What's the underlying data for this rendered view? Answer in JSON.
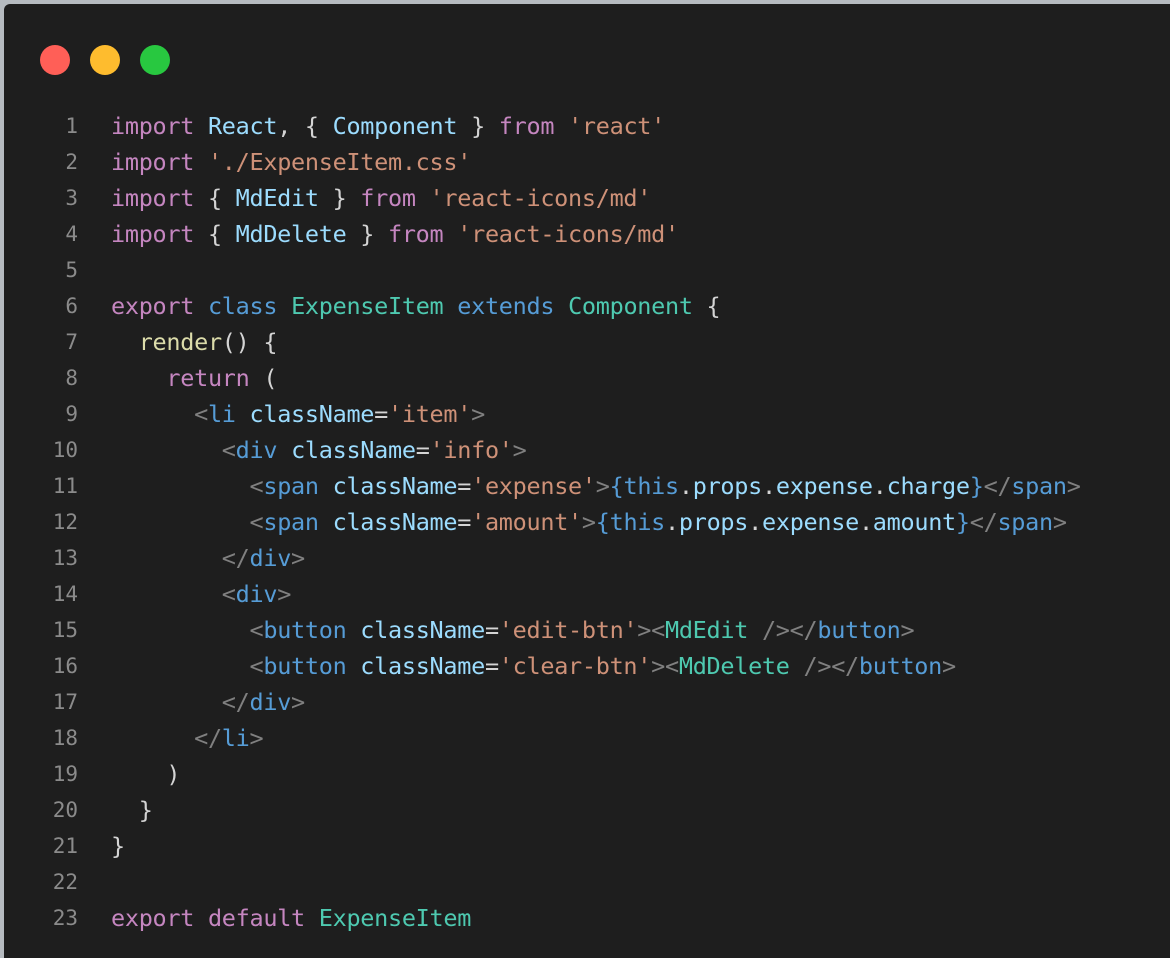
{
  "window": {
    "controls": [
      {
        "name": "close",
        "color": "#ff5f57"
      },
      {
        "name": "minimize",
        "color": "#febc2e"
      },
      {
        "name": "maximize",
        "color": "#28c840"
      }
    ]
  },
  "code": {
    "language": "jsx",
    "lines": [
      {
        "number": "1",
        "tokens": [
          [
            "kw-import",
            "import"
          ],
          [
            "punc",
            " "
          ],
          [
            "id",
            "React"
          ],
          [
            "punc",
            ", { "
          ],
          [
            "id",
            "Component"
          ],
          [
            "punc",
            " } "
          ],
          [
            "kw-import",
            "from"
          ],
          [
            "punc",
            " "
          ],
          [
            "str",
            "'react'"
          ]
        ]
      },
      {
        "number": "2",
        "tokens": [
          [
            "kw-import",
            "import"
          ],
          [
            "punc",
            " "
          ],
          [
            "str",
            "'./ExpenseItem.css'"
          ]
        ]
      },
      {
        "number": "3",
        "tokens": [
          [
            "kw-import",
            "import"
          ],
          [
            "punc",
            " { "
          ],
          [
            "id",
            "MdEdit"
          ],
          [
            "punc",
            " } "
          ],
          [
            "kw-import",
            "from"
          ],
          [
            "punc",
            " "
          ],
          [
            "str",
            "'react-icons/md'"
          ]
        ]
      },
      {
        "number": "4",
        "tokens": [
          [
            "kw-import",
            "import"
          ],
          [
            "punc",
            " { "
          ],
          [
            "id",
            "MdDelete"
          ],
          [
            "punc",
            " } "
          ],
          [
            "kw-import",
            "from"
          ],
          [
            "punc",
            " "
          ],
          [
            "str",
            "'react-icons/md'"
          ]
        ]
      },
      {
        "number": "5",
        "tokens": []
      },
      {
        "number": "6",
        "tokens": [
          [
            "kw-import",
            "export"
          ],
          [
            "punc",
            " "
          ],
          [
            "kw-blue",
            "class"
          ],
          [
            "punc",
            " "
          ],
          [
            "cls",
            "ExpenseItem"
          ],
          [
            "punc",
            " "
          ],
          [
            "kw-blue",
            "extends"
          ],
          [
            "punc",
            " "
          ],
          [
            "cls",
            "Component"
          ],
          [
            "punc",
            " {"
          ]
        ]
      },
      {
        "number": "7",
        "tokens": [
          [
            "punc",
            "  "
          ],
          [
            "fn",
            "render"
          ],
          [
            "punc",
            "() {"
          ]
        ]
      },
      {
        "number": "8",
        "tokens": [
          [
            "punc",
            "    "
          ],
          [
            "kw-import",
            "return"
          ],
          [
            "punc",
            " ("
          ]
        ]
      },
      {
        "number": "9",
        "tokens": [
          [
            "punc",
            "      "
          ],
          [
            "tagp",
            "<"
          ],
          [
            "tag",
            "li"
          ],
          [
            "punc",
            " "
          ],
          [
            "attr",
            "className"
          ],
          [
            "punc",
            "="
          ],
          [
            "str",
            "'item'"
          ],
          [
            "tagp",
            ">"
          ]
        ]
      },
      {
        "number": "10",
        "tokens": [
          [
            "punc",
            "        "
          ],
          [
            "tagp",
            "<"
          ],
          [
            "tag",
            "div"
          ],
          [
            "punc",
            " "
          ],
          [
            "attr",
            "className"
          ],
          [
            "punc",
            "="
          ],
          [
            "str",
            "'info'"
          ],
          [
            "tagp",
            ">"
          ]
        ]
      },
      {
        "number": "11",
        "tokens": [
          [
            "punc",
            "          "
          ],
          [
            "tagp",
            "<"
          ],
          [
            "tag",
            "span"
          ],
          [
            "punc",
            " "
          ],
          [
            "attr",
            "className"
          ],
          [
            "punc",
            "="
          ],
          [
            "str",
            "'expense'"
          ],
          [
            "tagp",
            ">"
          ],
          [
            "jsx",
            "{"
          ],
          [
            "kw-blue",
            "this"
          ],
          [
            "punc",
            "."
          ],
          [
            "id",
            "props"
          ],
          [
            "punc",
            "."
          ],
          [
            "id",
            "expense"
          ],
          [
            "punc",
            "."
          ],
          [
            "id",
            "charge"
          ],
          [
            "jsx",
            "}"
          ],
          [
            "tagp",
            "</"
          ],
          [
            "tag",
            "span"
          ],
          [
            "tagp",
            ">"
          ]
        ]
      },
      {
        "number": "12",
        "tokens": [
          [
            "punc",
            "          "
          ],
          [
            "tagp",
            "<"
          ],
          [
            "tag",
            "span"
          ],
          [
            "punc",
            " "
          ],
          [
            "attr",
            "className"
          ],
          [
            "punc",
            "="
          ],
          [
            "str",
            "'amount'"
          ],
          [
            "tagp",
            ">"
          ],
          [
            "jsx",
            "{"
          ],
          [
            "kw-blue",
            "this"
          ],
          [
            "punc",
            "."
          ],
          [
            "id",
            "props"
          ],
          [
            "punc",
            "."
          ],
          [
            "id",
            "expense"
          ],
          [
            "punc",
            "."
          ],
          [
            "id",
            "amount"
          ],
          [
            "jsx",
            "}"
          ],
          [
            "tagp",
            "</"
          ],
          [
            "tag",
            "span"
          ],
          [
            "tagp",
            ">"
          ]
        ]
      },
      {
        "number": "13",
        "tokens": [
          [
            "punc",
            "        "
          ],
          [
            "tagp",
            "</"
          ],
          [
            "tag",
            "div"
          ],
          [
            "tagp",
            ">"
          ]
        ]
      },
      {
        "number": "14",
        "tokens": [
          [
            "punc",
            "        "
          ],
          [
            "tagp",
            "<"
          ],
          [
            "tag",
            "div"
          ],
          [
            "tagp",
            ">"
          ]
        ]
      },
      {
        "number": "15",
        "tokens": [
          [
            "punc",
            "          "
          ],
          [
            "tagp",
            "<"
          ],
          [
            "tag",
            "button"
          ],
          [
            "punc",
            " "
          ],
          [
            "attr",
            "className"
          ],
          [
            "punc",
            "="
          ],
          [
            "str",
            "'edit-btn'"
          ],
          [
            "tagp",
            "><"
          ],
          [
            "cls",
            "MdEdit"
          ],
          [
            "punc",
            " "
          ],
          [
            "tagp",
            "/></"
          ],
          [
            "tag",
            "button"
          ],
          [
            "tagp",
            ">"
          ]
        ]
      },
      {
        "number": "16",
        "tokens": [
          [
            "punc",
            "          "
          ],
          [
            "tagp",
            "<"
          ],
          [
            "tag",
            "button"
          ],
          [
            "punc",
            " "
          ],
          [
            "attr",
            "className"
          ],
          [
            "punc",
            "="
          ],
          [
            "str",
            "'clear-btn'"
          ],
          [
            "tagp",
            "><"
          ],
          [
            "cls",
            "MdDelete"
          ],
          [
            "punc",
            " "
          ],
          [
            "tagp",
            "/></"
          ],
          [
            "tag",
            "button"
          ],
          [
            "tagp",
            ">"
          ]
        ]
      },
      {
        "number": "17",
        "tokens": [
          [
            "punc",
            "        "
          ],
          [
            "tagp",
            "</"
          ],
          [
            "tag",
            "div"
          ],
          [
            "tagp",
            ">"
          ]
        ]
      },
      {
        "number": "18",
        "tokens": [
          [
            "punc",
            "      "
          ],
          [
            "tagp",
            "</"
          ],
          [
            "tag",
            "li"
          ],
          [
            "tagp",
            ">"
          ]
        ]
      },
      {
        "number": "19",
        "tokens": [
          [
            "punc",
            "    )"
          ]
        ]
      },
      {
        "number": "20",
        "tokens": [
          [
            "punc",
            "  }"
          ]
        ]
      },
      {
        "number": "21",
        "tokens": [
          [
            "punc",
            "}"
          ]
        ]
      },
      {
        "number": "22",
        "tokens": []
      },
      {
        "number": "23",
        "tokens": [
          [
            "kw-import",
            "export"
          ],
          [
            "punc",
            " "
          ],
          [
            "kw-import",
            "default"
          ],
          [
            "punc",
            " "
          ],
          [
            "cls",
            "ExpenseItem"
          ]
        ]
      }
    ]
  }
}
